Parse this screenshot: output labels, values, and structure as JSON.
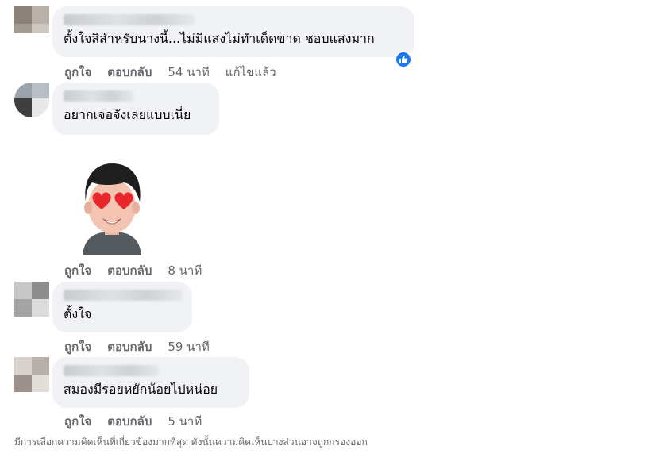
{
  "comments": [
    {
      "text": "ตั้งใจสิสำหรับนางนี้...ไม่มีแสงไม่ทำเด็ดขาด ชอบแสงมาก",
      "like": "ถูกใจ",
      "reply": "ตอบกลับ",
      "time": "54 นาที",
      "edited": "แก้ไขแล้ว",
      "reaction_icon": "thumbs-up-icon"
    },
    {
      "text": "อยากเจอจังเลยแบบเนี่ย",
      "like": "ถูกใจ",
      "reply": "ตอบกลับ",
      "time": "8 นาที",
      "sticker": "heart-eyes-avatar-sticker"
    },
    {
      "text": "ตั้งใจ",
      "like": "ถูกใจ",
      "reply": "ตอบกลับ",
      "time": "59 นาที"
    },
    {
      "text": "สมองมีรอยหยักน้อยไปหน่อย",
      "like": "ถูกใจ",
      "reply": "ตอบกลับ",
      "time": "5 นาที"
    }
  ],
  "footer_note": "มีการเลือกความคิดเห็นที่เกี่ยวข้องมากที่สุด ดังนั้นความคิดเห็นบางส่วนอาจถูกกรองออก",
  "colors": {
    "bubble": "#f0f2f5",
    "meta": "#65676b",
    "like_blue": "#1877f2"
  }
}
